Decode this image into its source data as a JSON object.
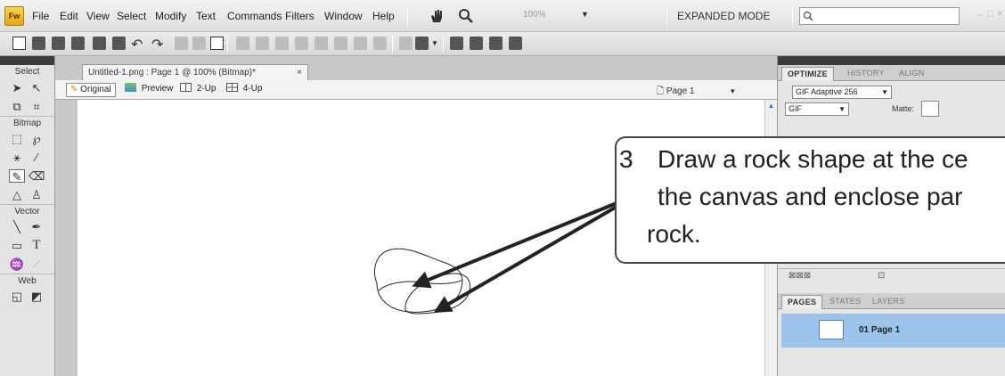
{
  "menubar": {
    "logo": "Fw",
    "items": [
      "File",
      "Edit",
      "View",
      "Select",
      "Modify",
      "Text",
      "Commands",
      "Filters",
      "Window",
      "Help"
    ],
    "zoom": "100%",
    "mode": "EXPANDED MODE",
    "search_placeholder": ""
  },
  "document": {
    "tab_title": "Untitled-1.png : Page 1 @ 100% (Bitmap)*",
    "close": "×",
    "views": [
      "Original",
      "Preview",
      "2-Up",
      "4-Up"
    ],
    "page_selector": "Page 1"
  },
  "tools": {
    "sections": [
      "Select",
      "Bitmap",
      "Vector",
      "Web"
    ]
  },
  "optimize_panel": {
    "tabs": [
      "OPTIMIZE",
      "HISTORY",
      "ALIGN"
    ],
    "preset": "GIF Adaptive 256",
    "format": "GIF",
    "matte_label": "Matte:"
  },
  "pages_panel": {
    "tabs": [
      "PAGES",
      "STATES",
      "LAYERS"
    ],
    "page_label": "01  Page 1"
  },
  "callout": {
    "number": "3",
    "line1": "Draw a rock shape at the ce",
    "line2": "the canvas and enclose par",
    "line3": "rock."
  },
  "colors": {
    "menu_bg": "#e6e6e6",
    "panel_grip": "#3c3c3c",
    "selected_page": "#9cc3ea",
    "arrow": "#222222"
  }
}
